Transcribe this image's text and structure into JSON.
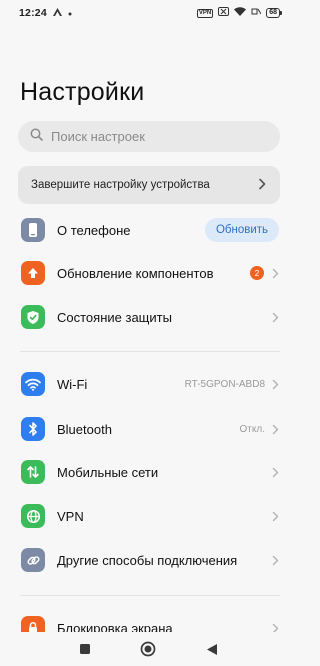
{
  "status_bar": {
    "time": "12:24",
    "vpn": "VPN",
    "battery": "68"
  },
  "page": {
    "title": "Настройки"
  },
  "search": {
    "placeholder": "Поиск настроек"
  },
  "setup_card": {
    "label": "Завершите настройку устройства"
  },
  "items": {
    "about": {
      "label": "О телефоне",
      "action": "Обновить",
      "icon": "phone-icon",
      "color": "#7c8aa5"
    },
    "components": {
      "label": "Обновление компонентов",
      "badge": "2",
      "icon": "arrow-up-icon",
      "color": "#f0621f"
    },
    "security": {
      "label": "Состояние защиты",
      "icon": "shield-check-icon",
      "color": "#3cbb5a"
    },
    "wifi": {
      "label": "Wi-Fi",
      "value": "RT-5GPON-ABD8",
      "icon": "wifi-icon",
      "color": "#2f7ef0"
    },
    "bluetooth": {
      "label": "Bluetooth",
      "value": "Откл.",
      "icon": "bluetooth-icon",
      "color": "#2f7ef0"
    },
    "mobile": {
      "label": "Мобильные сети",
      "icon": "mobile-data-icon",
      "color": "#3cbb5a"
    },
    "vpn": {
      "label": "VPN",
      "icon": "globe-icon",
      "color": "#3cbb5a"
    },
    "connections": {
      "label": "Другие способы подключения",
      "icon": "link-icon",
      "color": "#7c8aa5"
    },
    "lockscreen": {
      "label": "Блокировка экрана",
      "icon": "lock-icon",
      "color": "#f0621f"
    }
  },
  "colors": {
    "accent": "#2a72c8",
    "background": "#f7f7f7"
  }
}
